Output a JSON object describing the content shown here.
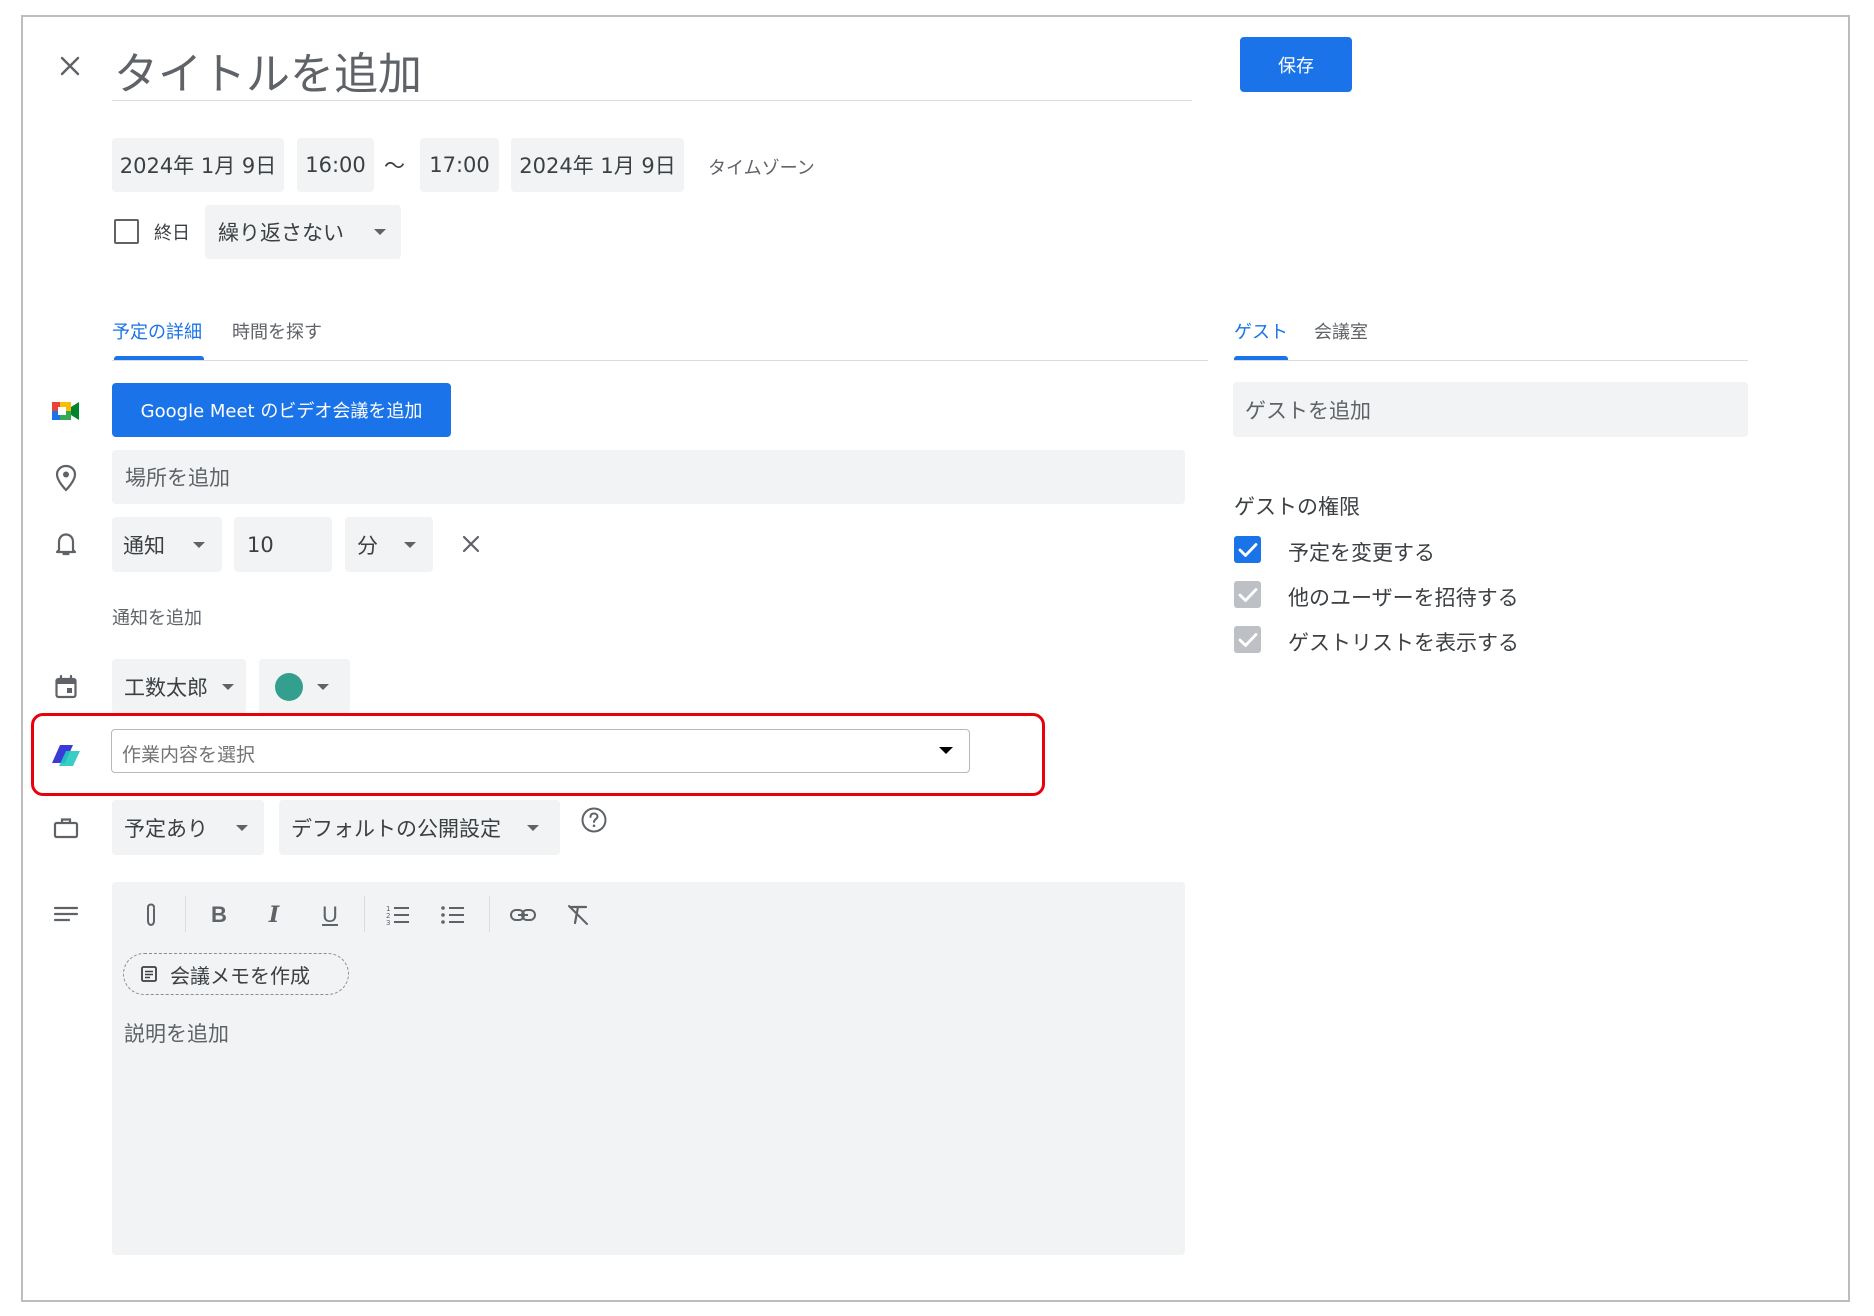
{
  "header": {
    "close_icon": "close-icon",
    "title_placeholder": "タイトルを追加",
    "save_label": "保存"
  },
  "datetime": {
    "start_date": "2024年 1月 9日",
    "start_time": "16:00",
    "separator": "〜",
    "end_time": "17:00",
    "end_date": "2024年 1月 9日",
    "timezone_label": "タイムゾーン"
  },
  "allday": {
    "label": "終日",
    "checked": false,
    "repeat_value": "繰り返さない"
  },
  "left_tabs": [
    {
      "label": "予定の詳細",
      "active": true
    },
    {
      "label": "時間を探す",
      "active": false
    }
  ],
  "right_tabs": [
    {
      "label": "ゲスト",
      "active": true
    },
    {
      "label": "会議室",
      "active": false
    }
  ],
  "meet": {
    "button_label": "Google Meet のビデオ会議を追加"
  },
  "location": {
    "placeholder": "場所を追加"
  },
  "notification": {
    "type": "通知",
    "value": "10",
    "unit": "分",
    "add_label": "通知を追加"
  },
  "calendar": {
    "owner": "工数太郎",
    "color": "#33a08f"
  },
  "work": {
    "placeholder": "作業内容を選択",
    "highlight_color": "#e8000b"
  },
  "availability": {
    "busy_value": "予定あり",
    "visibility_value": "デフォルトの公開設定"
  },
  "description": {
    "toolbar": {
      "bold": "B",
      "italic": "I",
      "underline": "U"
    },
    "notes_button": "会議メモを作成",
    "placeholder": "説明を追加"
  },
  "guests": {
    "placeholder": "ゲストを追加",
    "permissions_title": "ゲストの権限",
    "permissions": [
      {
        "label": "予定を変更する",
        "checked": true,
        "enabled": true
      },
      {
        "label": "他のユーザーを招待する",
        "checked": true,
        "enabled": false
      },
      {
        "label": "ゲストリストを表示する",
        "checked": true,
        "enabled": false
      }
    ]
  },
  "colors": {
    "accent": "#1a73e8",
    "field_bg": "#f1f3f4",
    "disabled_check": "#bdc1c6"
  }
}
